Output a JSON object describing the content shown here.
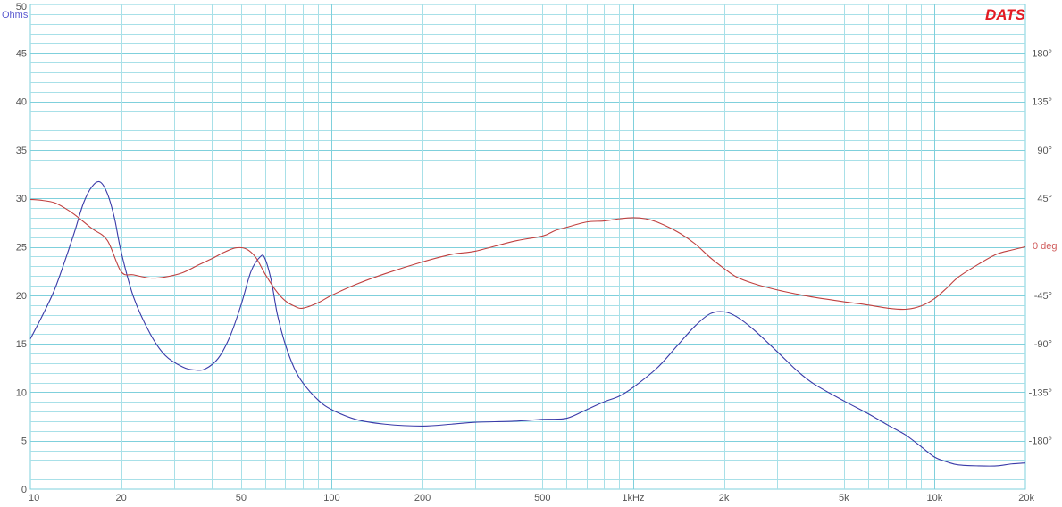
{
  "brand": "DATS",
  "chart_data": {
    "type": "line",
    "x_scale": "log",
    "xlim": [
      10,
      20000
    ],
    "ylim_left": [
      0,
      50
    ],
    "ylim_right": [
      -225,
      225
    ],
    "grid": true,
    "left_axis_unit": "Ohms",
    "right_axis_unit": "0 deg",
    "x_ticks": [
      {
        "value": 10,
        "label": "10"
      },
      {
        "value": 20,
        "label": "20"
      },
      {
        "value": 50,
        "label": "50"
      },
      {
        "value": 100,
        "label": "100"
      },
      {
        "value": 200,
        "label": "200"
      },
      {
        "value": 500,
        "label": "500"
      },
      {
        "value": 1000,
        "label": "1kHz"
      },
      {
        "value": 2000,
        "label": "2k"
      },
      {
        "value": 5000,
        "label": "5k"
      },
      {
        "value": 10000,
        "label": "10k"
      },
      {
        "value": 20000,
        "label": "20k"
      }
    ],
    "y_left_ticks": [
      {
        "value": 0,
        "label": "0"
      },
      {
        "value": 5,
        "label": "5"
      },
      {
        "value": 10,
        "label": "10"
      },
      {
        "value": 15,
        "label": "15"
      },
      {
        "value": 20,
        "label": "20"
      },
      {
        "value": 25,
        "label": "25"
      },
      {
        "value": 30,
        "label": "30"
      },
      {
        "value": 35,
        "label": "35"
      },
      {
        "value": 40,
        "label": "40"
      },
      {
        "value": 45,
        "label": "45"
      },
      {
        "value": 50,
        "label": "50"
      }
    ],
    "y_right_ticks": [
      {
        "value": 180,
        "label": "180°"
      },
      {
        "value": 135,
        "label": "135°"
      },
      {
        "value": 90,
        "label": "90°"
      },
      {
        "value": 45,
        "label": "45°"
      },
      {
        "value": -45,
        "label": "-45°"
      },
      {
        "value": -90,
        "label": "-90°"
      },
      {
        "value": -135,
        "label": "-135°"
      },
      {
        "value": -180,
        "label": "-180°"
      }
    ],
    "colors": {
      "impedance": "#3a3aa8",
      "phase": "#c0403f",
      "grid": "#a8e0e8",
      "grid_major": "#7fd0dc"
    },
    "series": [
      {
        "axis": "left",
        "color": "#3a3aa8",
        "points": [
          [
            10,
            15.5
          ],
          [
            11,
            18
          ],
          [
            12,
            20.5
          ],
          [
            13,
            23.5
          ],
          [
            14,
            26.5
          ],
          [
            15,
            29.5
          ],
          [
            16,
            31.2
          ],
          [
            17,
            31.7
          ],
          [
            18,
            30.5
          ],
          [
            19,
            28
          ],
          [
            20,
            24.5
          ],
          [
            22,
            19.8
          ],
          [
            25,
            16
          ],
          [
            28,
            13.8
          ],
          [
            32,
            12.6
          ],
          [
            35,
            12.3
          ],
          [
            38,
            12.4
          ],
          [
            42,
            13.5
          ],
          [
            46,
            15.8
          ],
          [
            50,
            19
          ],
          [
            54,
            22.5
          ],
          [
            58,
            24
          ],
          [
            60,
            23.8
          ],
          [
            63,
            21.5
          ],
          [
            66,
            18
          ],
          [
            70,
            15
          ],
          [
            75,
            12.5
          ],
          [
            80,
            11
          ],
          [
            90,
            9.2
          ],
          [
            100,
            8.2
          ],
          [
            120,
            7.2
          ],
          [
            150,
            6.7
          ],
          [
            200,
            6.5
          ],
          [
            250,
            6.7
          ],
          [
            300,
            6.9
          ],
          [
            400,
            7.0
          ],
          [
            500,
            7.2
          ],
          [
            600,
            7.3
          ],
          [
            700,
            8.2
          ],
          [
            800,
            9.0
          ],
          [
            900,
            9.6
          ],
          [
            1000,
            10.5
          ],
          [
            1200,
            12.5
          ],
          [
            1400,
            14.8
          ],
          [
            1600,
            16.8
          ],
          [
            1800,
            18.1
          ],
          [
            2000,
            18.3
          ],
          [
            2200,
            17.8
          ],
          [
            2500,
            16.5
          ],
          [
            3000,
            14.2
          ],
          [
            3500,
            12.2
          ],
          [
            4000,
            10.8
          ],
          [
            5000,
            9.1
          ],
          [
            6000,
            7.8
          ],
          [
            7000,
            6.6
          ],
          [
            8000,
            5.6
          ],
          [
            9000,
            4.4
          ],
          [
            10000,
            3.3
          ],
          [
            11000,
            2.8
          ],
          [
            12000,
            2.5
          ],
          [
            14000,
            2.4
          ],
          [
            16000,
            2.4
          ],
          [
            18000,
            2.6
          ],
          [
            20000,
            2.7
          ]
        ]
      },
      {
        "axis": "right",
        "color": "#c0403f",
        "points": [
          [
            10,
            44
          ],
          [
            11,
            43
          ],
          [
            12,
            41
          ],
          [
            13,
            36
          ],
          [
            14,
            30
          ],
          [
            16,
            17
          ],
          [
            18,
            6
          ],
          [
            20,
            -23
          ],
          [
            22,
            -26
          ],
          [
            25,
            -29
          ],
          [
            28,
            -28
          ],
          [
            32,
            -24
          ],
          [
            36,
            -17
          ],
          [
            40,
            -11
          ],
          [
            44,
            -5
          ],
          [
            48,
            -1
          ],
          [
            52,
            -2
          ],
          [
            56,
            -10
          ],
          [
            60,
            -25
          ],
          [
            65,
            -40
          ],
          [
            70,
            -50
          ],
          [
            75,
            -55
          ],
          [
            80,
            -57
          ],
          [
            90,
            -52
          ],
          [
            100,
            -45
          ],
          [
            120,
            -35
          ],
          [
            150,
            -25
          ],
          [
            200,
            -14
          ],
          [
            250,
            -7
          ],
          [
            300,
            -4
          ],
          [
            400,
            5
          ],
          [
            500,
            10
          ],
          [
            550,
            15
          ],
          [
            600,
            18
          ],
          [
            700,
            23
          ],
          [
            800,
            24
          ],
          [
            900,
            26
          ],
          [
            1000,
            27
          ],
          [
            1100,
            26
          ],
          [
            1200,
            23
          ],
          [
            1400,
            14
          ],
          [
            1600,
            3
          ],
          [
            1800,
            -10
          ],
          [
            2000,
            -20
          ],
          [
            2200,
            -28
          ],
          [
            2500,
            -34
          ],
          [
            3000,
            -40
          ],
          [
            3500,
            -44
          ],
          [
            4000,
            -47
          ],
          [
            5000,
            -51
          ],
          [
            6000,
            -54
          ],
          [
            7000,
            -57
          ],
          [
            8000,
            -58
          ],
          [
            9000,
            -55
          ],
          [
            10000,
            -48
          ],
          [
            11000,
            -38
          ],
          [
            12000,
            -28
          ],
          [
            14000,
            -16
          ],
          [
            16000,
            -7
          ],
          [
            18000,
            -3
          ],
          [
            20000,
            0
          ]
        ]
      }
    ]
  }
}
